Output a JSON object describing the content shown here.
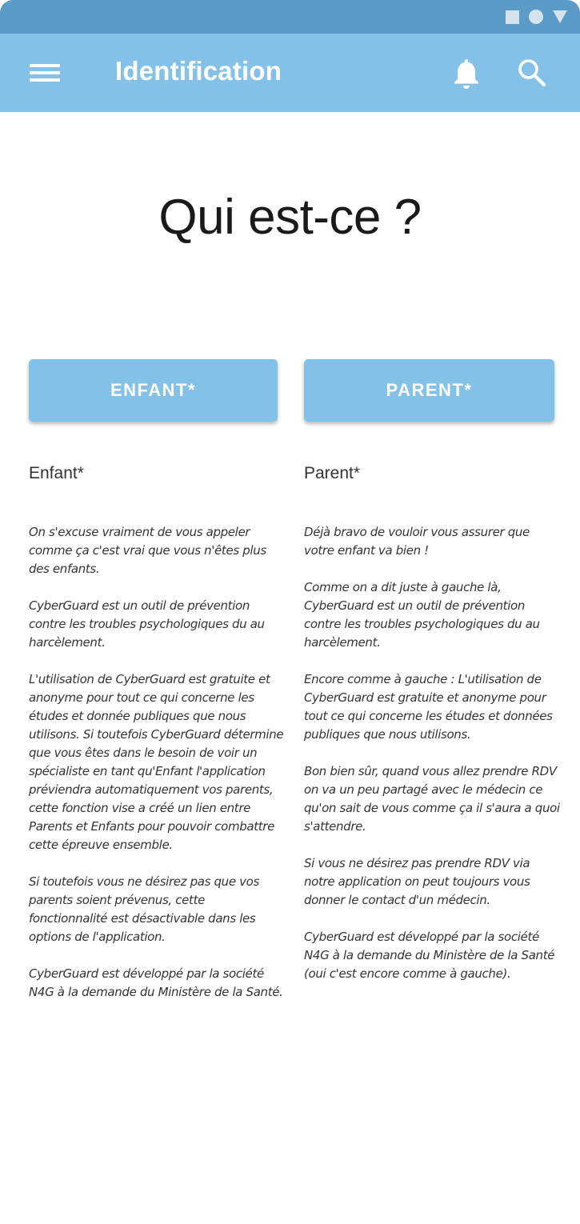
{
  "app_bar": {
    "title": "Identification",
    "icons": [
      "menu-icon",
      "bell-icon",
      "search-icon"
    ]
  },
  "status_bar": {
    "icons": [
      "square-icon",
      "circle-icon",
      "triangle-icon"
    ]
  },
  "headline": "Qui est-ce ?",
  "buttons": {
    "enfant": "ENFANT*",
    "parent": "PARENT*"
  },
  "enfant": {
    "heading": "Enfant*",
    "paragraphs": [
      "On s'excuse vraiment de vous appeler comme ça c'est vrai que vous n'êtes plus des enfants.",
      "CyberGuard est un outil de prévention contre les troubles psychologiques du au harcèlement.",
      "L'utilisation de CyberGuard est gratuite et anonyme pour tout ce qui concerne les études et donnée publiques que nous utilisons. Si toutefois CyberGuard détermine que vous êtes dans le besoin de voir un spécialiste en tant qu'Enfant l'application préviendra automatiquement vos parents, cette fonction vise a créé un lien entre Parents et Enfants pour pouvoir combattre cette épreuve ensemble.",
      "Si toutefois vous ne désirez pas que vos parents soient prévenus, cette fonctionnalité est désactivable dans les options de l'application.",
      "CyberGuard est développé par la société N4G à la demande du Ministère de la Santé."
    ]
  },
  "parent": {
    "heading": "Parent*",
    "paragraphs": [
      "Déjà bravo de vouloir vous assurer que votre enfant va bien !",
      "Comme on a dit juste à gauche là, CyberGuard est un outil de prévention contre les troubles psychologiques du au harcèlement.",
      "Encore comme à gauche : L'utilisation de CyberGuard est gratuite et anonyme pour tout ce qui concerne les études et données publiques que nous utilisons.",
      "Bon bien sûr, quand vous allez prendre RDV on va un peu partagé avec le médecin ce qu'on sait de vous comme ça il s'aura a quoi s'attendre.",
      "Si vous ne désirez pas prendre RDV via notre application on peut toujours vous donner le contact d'un médecin.",
      "CyberGuard est développé par la société N4G à la demande du Ministère de la Santé (oui c'est encore comme à gauche)."
    ]
  },
  "colors": {
    "status_bar": "#5a9bc8",
    "app_bar": "#84c1e8",
    "button": "#84c1e8"
  }
}
